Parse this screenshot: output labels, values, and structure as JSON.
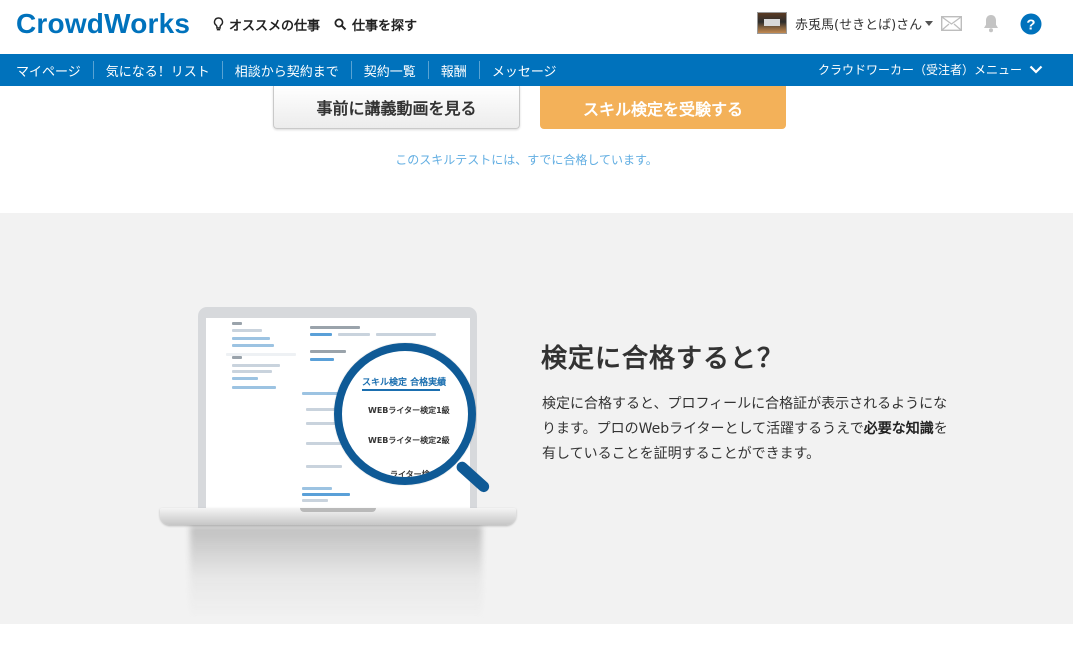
{
  "header": {
    "logo": "CrowdWorks",
    "nav_recommended": "オススメの仕事",
    "nav_search": "仕事を探す",
    "username": "赤兎馬(せきとば)さん",
    "icons": [
      "bulb-icon",
      "search-icon",
      "mail-icon",
      "bell-icon",
      "help-icon"
    ]
  },
  "navbar": {
    "items": [
      "マイページ",
      "気になる！リスト",
      "相談から契約まで",
      "契約一覧",
      "報酬",
      "メッセージ"
    ],
    "menu_label": "クラウドワーカー（受注者）メニュー"
  },
  "actions": {
    "lecture_button": "事前に講義動画を見る",
    "exam_button": "スキル検定を受験する",
    "passed_note": "このスキルテストには、すでに合格しています。"
  },
  "illustration": {
    "certificate_title": "スキル検定 合格実績",
    "row1": "WEBライター検定1級",
    "row2": "WEBライター検定2級",
    "row3": "ライター検"
  },
  "feature": {
    "title": "検定に合格すると？",
    "desc_part1": "検定に合格すると、プロフィールに合格証が表示されるようになります。プロのWebライターとして活躍するうえで",
    "desc_bold": "必要な知識",
    "desc_part2": "を有していることを証明することができます。"
  },
  "colors": {
    "brand_blue": "#0072bc",
    "exam_orange": "#f3b159",
    "note_blue": "#62aee2",
    "feature_bg": "#f2f2f2"
  }
}
